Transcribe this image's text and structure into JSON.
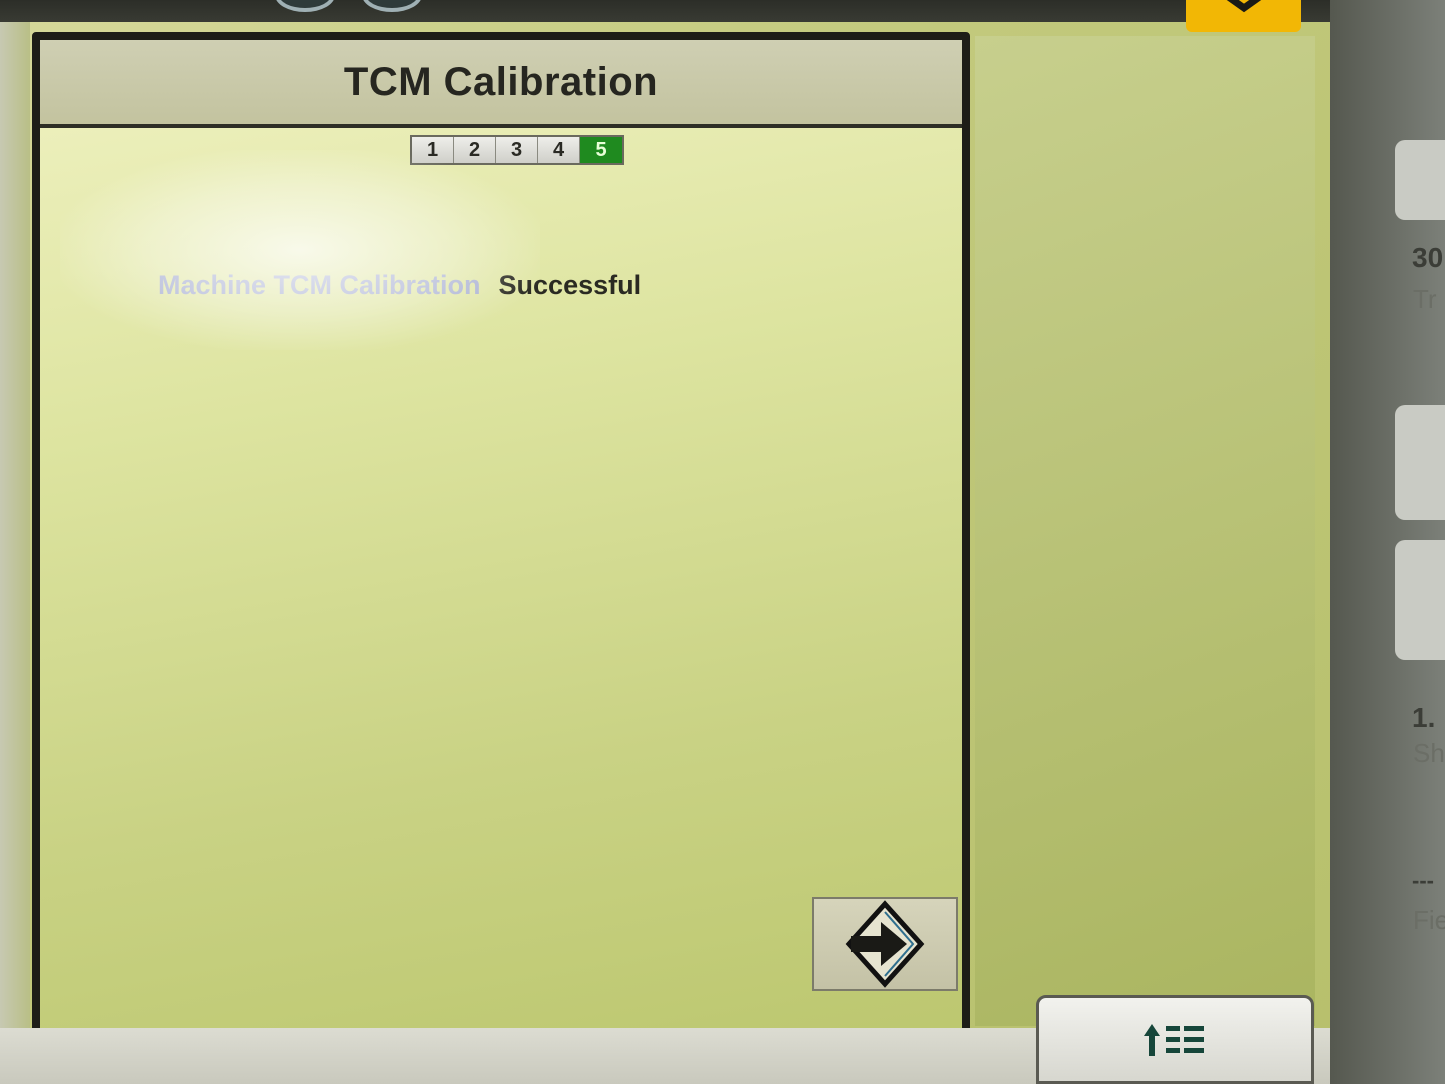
{
  "dialog": {
    "title": "TCM Calibration",
    "steps": [
      "1",
      "2",
      "3",
      "4",
      "5"
    ],
    "active_step": "5",
    "status_label": "Machine TCM Calibration",
    "status_value": "Successful",
    "next_button_icon": "arrow-right-icon"
  },
  "sidebar_partial": {
    "text1": "30",
    "sub1": "Tr",
    "text2": "1.",
    "sub2": "Sh",
    "text3": "---",
    "sub3": "Fie"
  },
  "toolbar": {
    "close_icon": "close-icon",
    "menu_icon": "menu-up-icon"
  },
  "colors": {
    "active_step": "#1f8a1f",
    "close_button": "#f2b705"
  }
}
